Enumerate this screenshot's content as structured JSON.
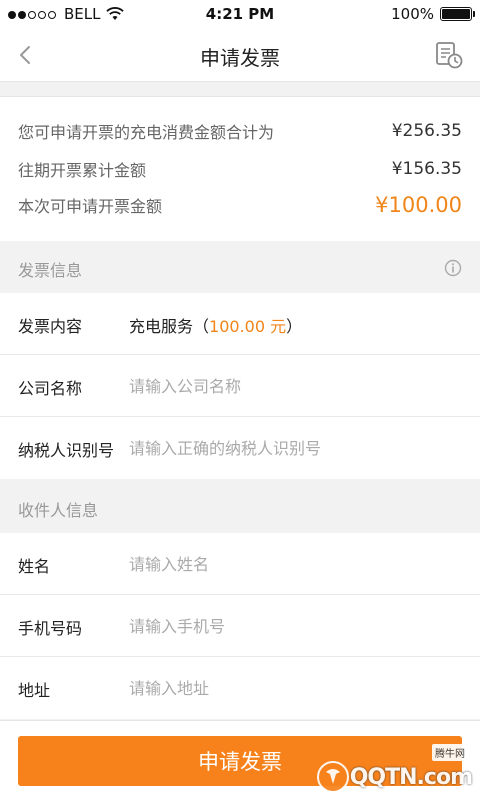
{
  "status_bar": {
    "carrier": "BELL",
    "time": "4:21 PM",
    "battery": "100%",
    "battery_level": 1.0
  },
  "nav": {
    "title": "申请发票",
    "back_icon": "chevron-left-icon",
    "history_icon": "invoice-history-icon"
  },
  "summary": {
    "rows": [
      {
        "label": "您可申请开票的充电消费金额合计为",
        "value": "¥256.35"
      },
      {
        "label": "往期开票累计金额",
        "value": "¥156.35"
      },
      {
        "label": "本次可申请开票金额",
        "value": "¥100.00"
      }
    ]
  },
  "invoice_section": {
    "title": "发票信息",
    "content_label": "发票内容",
    "content_value": "充电服务（",
    "content_amount": "100.00 元",
    "content_close": "）",
    "company_label": "公司名称",
    "company_placeholder": "请输入公司名称",
    "tax_label": "纳税人识别号",
    "tax_placeholder": "请输入正确的纳税人识别号"
  },
  "recipient_section": {
    "title": "收件人信息",
    "name_label": "姓名",
    "name_placeholder": "请输入姓名",
    "phone_label": "手机号码",
    "phone_placeholder": "请输入手机号",
    "address_label": "地址",
    "address_placeholder": "请输入地址"
  },
  "submit": {
    "label": "申请发票"
  },
  "watermark": {
    "text": "QQTN.com",
    "sub": "腾牛网"
  },
  "colors": {
    "accent": "#f08519",
    "button": "#f7821b"
  }
}
